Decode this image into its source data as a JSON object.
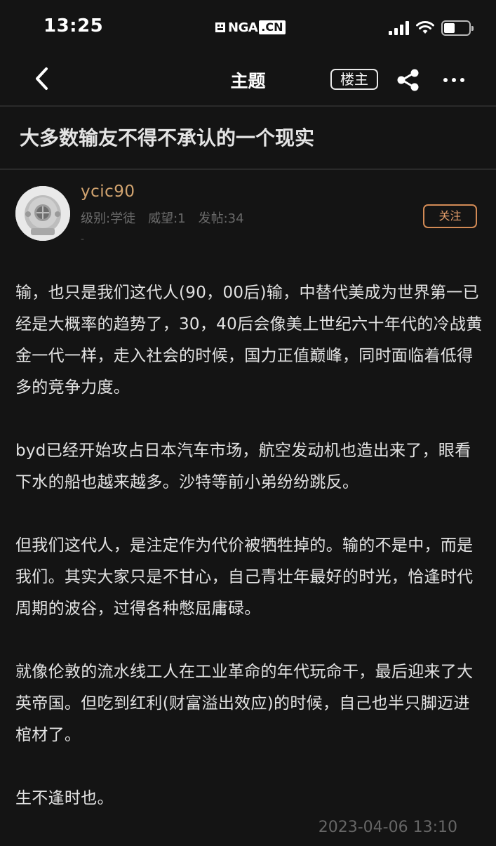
{
  "status_bar": {
    "time": "13:25",
    "carrier_logo": "NGA",
    "carrier_logo_suffix": ".CN",
    "signal_icon": "signal-icon",
    "wifi_icon": "wifi-icon",
    "battery_level": 0.45
  },
  "nav": {
    "back_icon": "chevron-left-icon",
    "title": "主题",
    "op_badge": "楼主",
    "share_icon": "share-icon",
    "more_icon": "more-icon"
  },
  "topic": {
    "title": "大多数输友不得不承认的一个现实"
  },
  "author": {
    "avatar_icon": "diving-helmet-avatar",
    "username": "ycic90",
    "level": "级别:学徒",
    "reputation": "威望:1",
    "posts": "发帖:34",
    "signature": "-",
    "follow_label": "关注"
  },
  "post": {
    "paragraphs": [
      "输，也只是我们这代人(90，00后)输，中替代美成为世界第一已经是大概率的趋势了，30，40后会像美上世纪六十年代的冷战黄金一代一样，走入社会的时候，国力正值巅峰，同时面临着低得多的竞争力度。",
      "byd已经开始攻占日本汽车市场，航空发动机也造出来了，眼看下水的船也越来越多。沙特等前小弟纷纷跳反。",
      "但我们这代人，是注定作为代价被牺牲掉的。输的不是中，而是我们。其实大家只是不甘心，自己青壮年最好的时光，恰逢时代周期的波谷，过得各种憋屈庸碌。",
      "就像伦敦的流水线工人在工业革命的年代玩命干，最后迎来了大英帝国。但吃到红利(财富溢出效应)的时候，自己也半只脚迈进棺材了。",
      "生不逢时也。"
    ],
    "timestamp": "2023-04-06 13:10"
  },
  "colors": {
    "background": "#141414",
    "username": "#d2a470",
    "follow_accent": "#d28a55",
    "meta_text": "#6a6a6a"
  }
}
